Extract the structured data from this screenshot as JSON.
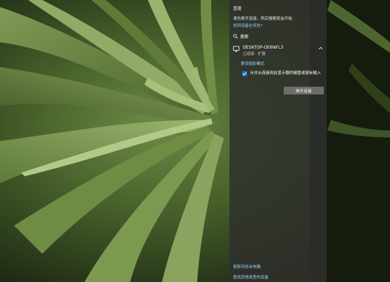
{
  "connect_panel": {
    "title": "连接",
    "description": "请先断开连接，然后搜索就会开始",
    "find_device_link": "找到设备在何处?",
    "search_label": "搜索",
    "device": {
      "name": "DESKTOP-OE6NFL3",
      "status": "已连接 · 扩展"
    },
    "change_projection_mode_link": "更改投影模式",
    "allow_input_checkbox": {
      "label": "允许从连接到此显示器的键盘或鼠标输入",
      "checked": true
    },
    "disconnect_button": "断开连接",
    "project_to_pc_link": "投影到这台电脑",
    "find_other_device_link": "查找其他类型的设备"
  },
  "colors": {
    "panel_background": "#2e302c",
    "link": "#9bd2ff",
    "checkbox_accent": "#1e78d8",
    "button_background": "#787874"
  },
  "icons": {
    "search": "search-icon",
    "device": "monitor-icon",
    "expand": "chevron-up-icon",
    "check": "checkmark-icon"
  }
}
